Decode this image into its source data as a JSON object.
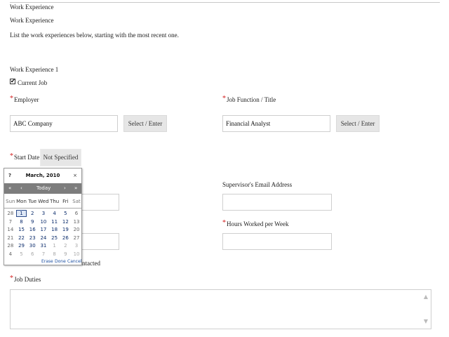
{
  "section": {
    "header_label": "Work Experience",
    "title": "Work Experience",
    "instructions": "List the work experiences below, starting with the most recent one.",
    "entry_title": "Work Experience 1"
  },
  "form": {
    "current_job": {
      "label": "Current Job",
      "checked": true,
      "checkmark": "✔"
    },
    "employer": {
      "label": "Employer",
      "value": "ABC Company",
      "button_label": "Select / Enter"
    },
    "job_function": {
      "label": "Job Function / Title",
      "value": "Financial Analyst",
      "button_label": "Select / Enter"
    },
    "start_date": {
      "label": "Start Date",
      "button_label": "Not Specified"
    },
    "supervisor_email": {
      "label": "Supervisor's Email Address",
      "value": ""
    },
    "hours_per_week": {
      "label": "Hours Worked per Week",
      "value": ""
    },
    "contact_partial_label": "ntacted",
    "job_duties": {
      "label": "Job Duties",
      "value": ""
    },
    "required_mark": "*"
  },
  "calendar": {
    "help": "?",
    "month_label": "March, 2010",
    "close": "×",
    "nav": {
      "prev_year": "«",
      "prev_month": "‹",
      "today": "Today",
      "next_month": "›",
      "next_year": "»"
    },
    "weekdays": [
      "Sun",
      "Mon",
      "Tue",
      "Wed",
      "Thu",
      "Fri",
      "Sat"
    ],
    "weeks": [
      {
        "wk": "28",
        "days": [
          "",
          "1",
          "2",
          "3",
          "4",
          "5",
          "6"
        ]
      },
      {
        "wk": "7",
        "days": [
          "",
          "8",
          "9",
          "10",
          "11",
          "12",
          "13"
        ]
      },
      {
        "wk": "14",
        "days": [
          "",
          "15",
          "16",
          "17",
          "18",
          "19",
          "20"
        ]
      },
      {
        "wk": "21",
        "days": [
          "",
          "22",
          "23",
          "24",
          "25",
          "26",
          "27"
        ]
      },
      {
        "wk": "28",
        "days": [
          "",
          "29",
          "30",
          "31",
          "1",
          "2",
          "3"
        ]
      },
      {
        "wk": "4",
        "days": [
          "",
          "5",
          "6",
          "7",
          "8",
          "9",
          "10"
        ]
      }
    ],
    "selected_day": "1",
    "footer": {
      "erase": "Erase",
      "done": "Done",
      "cancel": "Cancel"
    }
  },
  "icons": {
    "scroll_up": "scroll-up-arrow-icon",
    "scroll_down": "scroll-down-arrow-icon"
  },
  "colors": {
    "required": "#d42020",
    "calendar_nav": "#7d7d7d",
    "calendar_day": "#0a2b6b"
  }
}
